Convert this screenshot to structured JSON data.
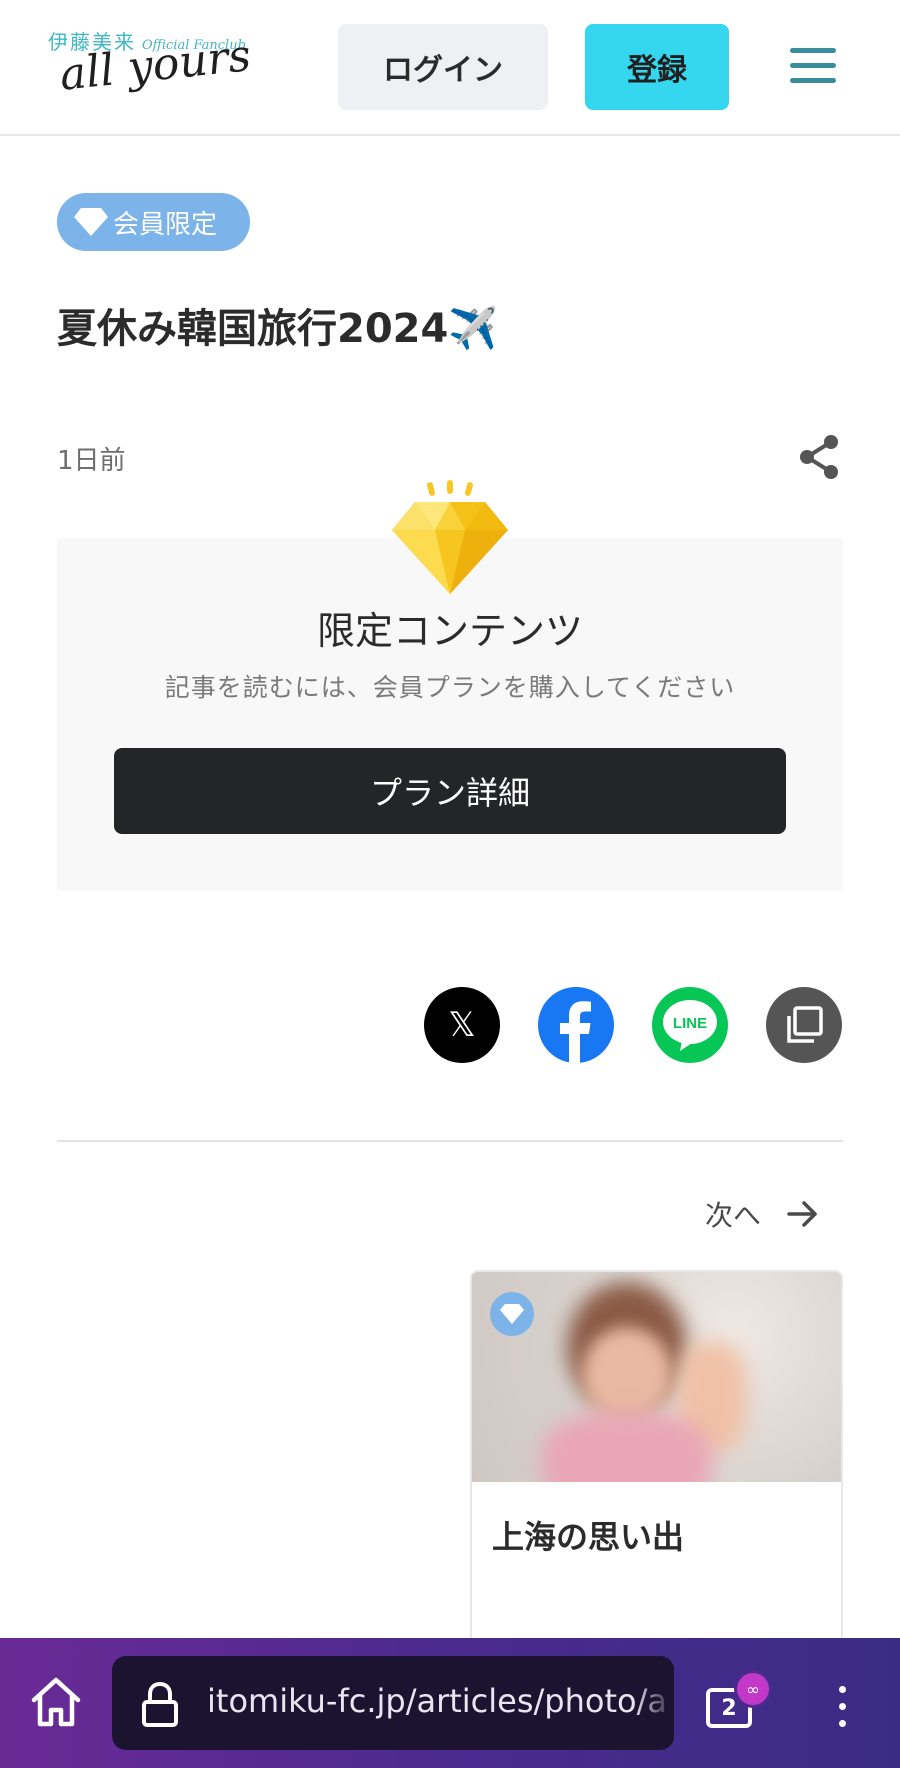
{
  "header": {
    "logo_top": "伊藤美来",
    "logo_top_sub": "Official Fanclub",
    "logo_main": "all yours",
    "login_label": "ログイン",
    "register_label": "登録"
  },
  "article": {
    "badge_label": "会員限定",
    "title": "夏休み韓国旅行2024✈️",
    "date": "1日前"
  },
  "locked": {
    "title": "限定コンテンツ",
    "subtitle": "記事を読むには、会員プランを購入してください",
    "button_label": "プラン詳細"
  },
  "share": {
    "x_label": "𝕏",
    "icons": [
      "x-icon",
      "facebook-icon",
      "line-icon",
      "copy-icon"
    ],
    "line_text": "LINE"
  },
  "pagination": {
    "next_label": "次へ"
  },
  "next_card": {
    "title": "上海の思い出"
  },
  "browser": {
    "url": "itomiku-fc.jp/articles/photo/a",
    "tab_count": "2"
  },
  "colors": {
    "accent_cyan": "#35d7ef",
    "badge_blue": "#7cb3e8",
    "dark_button": "#242529",
    "facebook": "#1877f2",
    "line": "#06c755"
  }
}
